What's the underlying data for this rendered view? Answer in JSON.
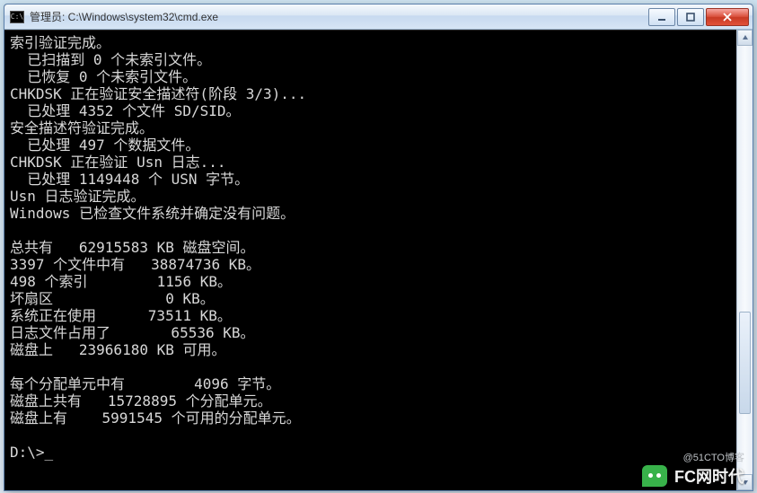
{
  "window": {
    "title": "管理员: C:\\Windows\\system32\\cmd.exe",
    "icon_label": "C:\\"
  },
  "output": {
    "lines": [
      "索引验证完成。",
      "  已扫描到 0 个未索引文件。",
      "  已恢复 0 个未索引文件。",
      "CHKDSK 正在验证安全描述符(阶段 3/3)...",
      "  已处理 4352 个文件 SD/SID。",
      "安全描述符验证完成。",
      "  已处理 497 个数据文件。",
      "CHKDSK 正在验证 Usn 日志...",
      "  已处理 1149448 个 USN 字节。",
      "Usn 日志验证完成。",
      "Windows 已检查文件系统并确定没有问题。",
      "",
      "总共有   62915583 KB 磁盘空间。",
      "3397 个文件中有   38874736 KB。",
      "498 个索引        1156 KB。",
      "坏扇区             0 KB。",
      "系统正在使用      73511 KB。",
      "日志文件占用了       65536 KB。",
      "磁盘上   23966180 KB 可用。",
      "",
      "每个分配单元中有        4096 字节。",
      "磁盘上共有   15728895 个分配单元。",
      "磁盘上有    5991545 个可用的分配单元。",
      "",
      "D:\\>_"
    ]
  },
  "watermark": {
    "main": "FC网时代",
    "sub": "@51CTO博客"
  },
  "colors": {
    "bg": "#000000",
    "fg": "#d8d8d8",
    "close": "#d94f3a"
  }
}
